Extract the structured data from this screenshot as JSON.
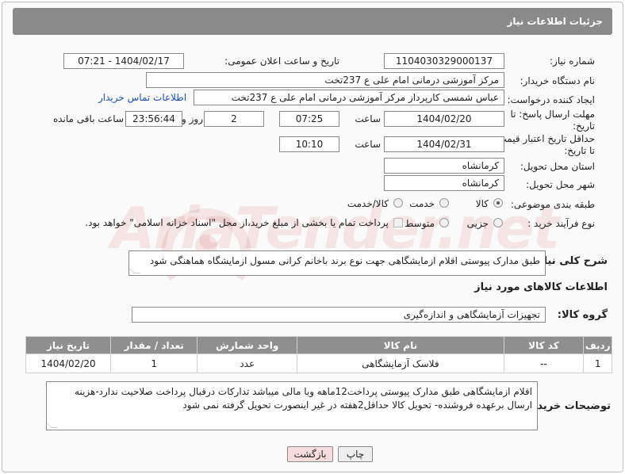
{
  "header": {
    "title": "جزئیات اطلاعات نیاز"
  },
  "fields": {
    "need_number_label": "شماره نیاز:",
    "need_number": "1104030329000137",
    "announce_label": "تاریخ و ساعت اعلان عمومی:",
    "announce_value": "1404/02/17 - 07:21",
    "buyer_org_label": "نام دستگاه خریدار:",
    "buyer_org": "مرکز آموزشی درمانی امام علی ع 237تخت",
    "creator_label": "ایجاد کننده درخواست:",
    "creator": "عباس شمسی کارپرداز  مرکز آموزشی درمانی امام علی ع 237تخت",
    "contact_link": "اطلاعات تماس خریدار",
    "reply_deadline_label_1": "مهلت ارسال پاسخ: تا",
    "reply_deadline_label_2": "تاریخ:",
    "reply_date": "1404/02/20",
    "time_label": "ساعت",
    "reply_time": "07:25",
    "days_value": "2",
    "days_label": "روز و",
    "remaining_time": "23:56:44",
    "remaining_label": "ساعت باقی مانده",
    "price_validity_label_1": "حداقل تاریخ اعتبار قیمت:",
    "price_validity_label_2": "تا تاریخ:",
    "validity_date": "1404/02/31",
    "validity_time": "10:10",
    "province_label": "استان محل تحویل:",
    "province": "کرمانشاه",
    "city_label": "شهر محل تحویل:",
    "city": "کرمانشاه",
    "category_label": "طبقه بندی موضوعی:",
    "category_options": [
      "کالا",
      "خدمت",
      "کالا/خدمت"
    ],
    "purchase_type_label": "نوع فرآیند خرید :",
    "purchase_options": [
      "جزیی",
      "متوسط"
    ],
    "treasury_note": "پرداخت تمام یا بخشی از مبلغ خرید،از محل \"اسناد خزانه اسلامی\" خواهد بود.",
    "description_label": "شرح کلی نیاز:",
    "description": "طبق مدارک پیوستی اقلام ازمایشگاهی جهت نوع برند باخانم کرانی مسول ازمایشگاه هماهنگی شود",
    "goods_info_title": "اطلاعات کالاهای مورد نیاز",
    "goods_group_label": "گروه کالا:",
    "goods_group": "تجهیزات آزمایشگاهی و اندازه‌گیری"
  },
  "table": {
    "headers": [
      "ردیف",
      "کد کالا",
      "نام کالا",
      "واحد شمارش",
      "تعداد / مقدار",
      "تاریخ نیاز"
    ],
    "rows": [
      [
        "1",
        "--",
        "فلاسک آزمایشگاهی",
        "عدد",
        "1",
        "1404/02/20"
      ]
    ]
  },
  "buyer_notes": {
    "label": "توضیحات خریدار:",
    "text": "اقلام ازمایشگاهی طبق مدارک پیوستی پرداخت12ماهه وبا مالی میباشد تدارکات درقبال پرداخت صلاحیت ندارد-هزینه ارسال برعهده فروشنده- تحویل کالا حداقل2هفته در غیر اینصورت تحویل گرفته نمی شود"
  },
  "buttons": {
    "print": "چاپ",
    "back": "بازگشت"
  },
  "watermark": {
    "text": "AriaTender.net"
  },
  "colors": {
    "header_bg": "#8a8a8a",
    "link": "#1a4fbf",
    "back_button_bg": "#f6dcdc"
  }
}
